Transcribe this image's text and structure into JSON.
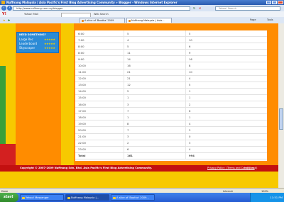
{
  "window": {
    "title": "Nuffnang Malaysia | Asia Pacific's First Blog Advertising Community » Blogger - Windows Internet Explorer"
  },
  "address": {
    "url": "http://www.nuffnang.com.my/blogger"
  },
  "search": {
    "placeholder": "Yahoo! Search"
  },
  "toolbar": {
    "mail_label": "Yahoo! Mail",
    "web_search_label": "Web Search"
  },
  "tabs": [
    {
      "label": "A slice of 'Bootha' 2009",
      "active": false
    },
    {
      "label": "Nuffnang Malaysia | Asia...",
      "active": true
    }
  ],
  "tab_tools": {
    "page": "Page",
    "tools": "Tools"
  },
  "left_box": {
    "title": "NEED SOMETHING?",
    "items": [
      "Large Rec",
      "Leaderboard",
      "Skyscraper"
    ],
    "stars": "★★★★★"
  },
  "table": {
    "rows": [
      {
        "time": "6:00",
        "col2": "5",
        "col3": "5"
      },
      {
        "time": "7:00",
        "col2": "4",
        "col3": "10"
      },
      {
        "time": "8:00",
        "col2": "5",
        "col3": "6"
      },
      {
        "time": "8:00",
        "col2": "11",
        "col3": "9"
      },
      {
        "time": "9:00",
        "col2": "14",
        "col3": "16"
      },
      {
        "time": "10:00",
        "col2": "16",
        "col3": "8"
      },
      {
        "time": "11:00",
        "col2": "21",
        "col3": "10"
      },
      {
        "time": "12:00",
        "col2": "21",
        "col3": "4"
      },
      {
        "time": "13:00",
        "col2": "12",
        "col3": "5"
      },
      {
        "time": "14:00",
        "col2": "5",
        "col3": "1"
      },
      {
        "time": "15:00",
        "col2": "1",
        "col3": "1"
      },
      {
        "time": "16:00",
        "col2": "3",
        "col3": "2"
      },
      {
        "time": "17:00",
        "col2": "7",
        "col3": "6"
      },
      {
        "time": "18:00",
        "col2": "1",
        "col3": "1"
      },
      {
        "time": "19:00",
        "col2": "8",
        "col3": "4"
      },
      {
        "time": "20:00",
        "col2": "7",
        "col3": "3"
      },
      {
        "time": "21:00",
        "col2": "3",
        "col3": "0"
      },
      {
        "time": "22:00",
        "col2": "2",
        "col3": "3"
      },
      {
        "time": "23:00",
        "col2": "6",
        "col3": "4"
      }
    ],
    "total": {
      "label": "Total",
      "col2": "161",
      "col3": "994"
    }
  },
  "footer": {
    "copyright": "Copyright © 2007-2009 Nuffnang Sdn. Bhd. Asia Pacific's First Blog Advertising Community.",
    "links": "Privacy Policy | Terms and Conditions",
    "back_to_top": "top (back)"
  },
  "statusbar": {
    "status": "Done",
    "zone": "Internet",
    "zoom": "100%"
  },
  "taskbar": {
    "start": "start",
    "tasks": [
      {
        "label": "Yahoo! Messenger",
        "active": false
      },
      {
        "label": "Nuffnang Malaysia |...",
        "active": true
      },
      {
        "label": "A slice of 'Bootha' 2009...",
        "active": false
      }
    ],
    "clock": "11:51 PM"
  },
  "colors": {
    "page_bg": "#ff8c00",
    "footer_bg": "#c31010",
    "left_box": "#2c8bd6"
  }
}
